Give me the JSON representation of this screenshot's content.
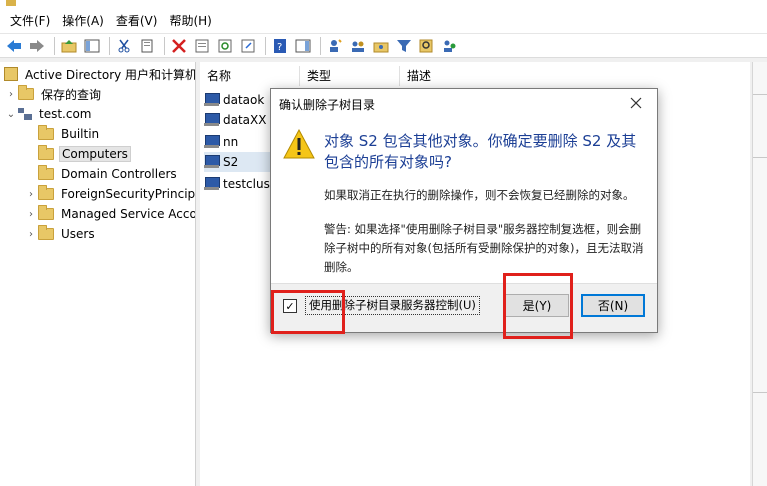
{
  "menubar": {
    "items": [
      {
        "label": "文件(F)"
      },
      {
        "label": "操作(A)"
      },
      {
        "label": "查看(V)"
      },
      {
        "label": "帮助(H)"
      }
    ]
  },
  "tree": {
    "root": "Active Directory 用户和计算机",
    "saved_queries": "保存的查询",
    "domain": "test.com",
    "children": [
      {
        "label": "Builtin"
      },
      {
        "label": "Computers"
      },
      {
        "label": "Domain Controllers"
      },
      {
        "label": "ForeignSecurityPrincipa"
      },
      {
        "label": "Managed Service Acco"
      },
      {
        "label": "Users"
      }
    ],
    "selected": "Computers"
  },
  "list": {
    "columns": [
      {
        "label": "名称"
      },
      {
        "label": "类型"
      },
      {
        "label": "描述"
      }
    ],
    "rows": [
      {
        "name": "dataok"
      },
      {
        "name": "dataXX"
      },
      {
        "name": "nn"
      },
      {
        "name": "S2"
      },
      {
        "name": "testclust"
      }
    ],
    "selected": "S2"
  },
  "dialog": {
    "title": "确认删除子树目录",
    "main_instruction": "对象 S2 包含其他对象。你确定要删除 S2 及其包含的所有对象吗?",
    "info": "如果取消正在执行的删除操作，则不会恢复已经删除的对象。",
    "warning": "警告: 如果选择\"使用删除子树目录\"服务器控制复选框，则会删除子树中的所有对象(包括所有受删除保护的对象)，且无法取消删除。",
    "checkbox_label": "使用删除子树目录服务器控制(U)",
    "checkbox_checked": true,
    "yes_label": "是(Y)",
    "no_label": "否(N)"
  },
  "colors": {
    "instruction_text": "#1c3f95",
    "annotation_red": "#e0201b",
    "default_button_border": "#0078d7"
  }
}
